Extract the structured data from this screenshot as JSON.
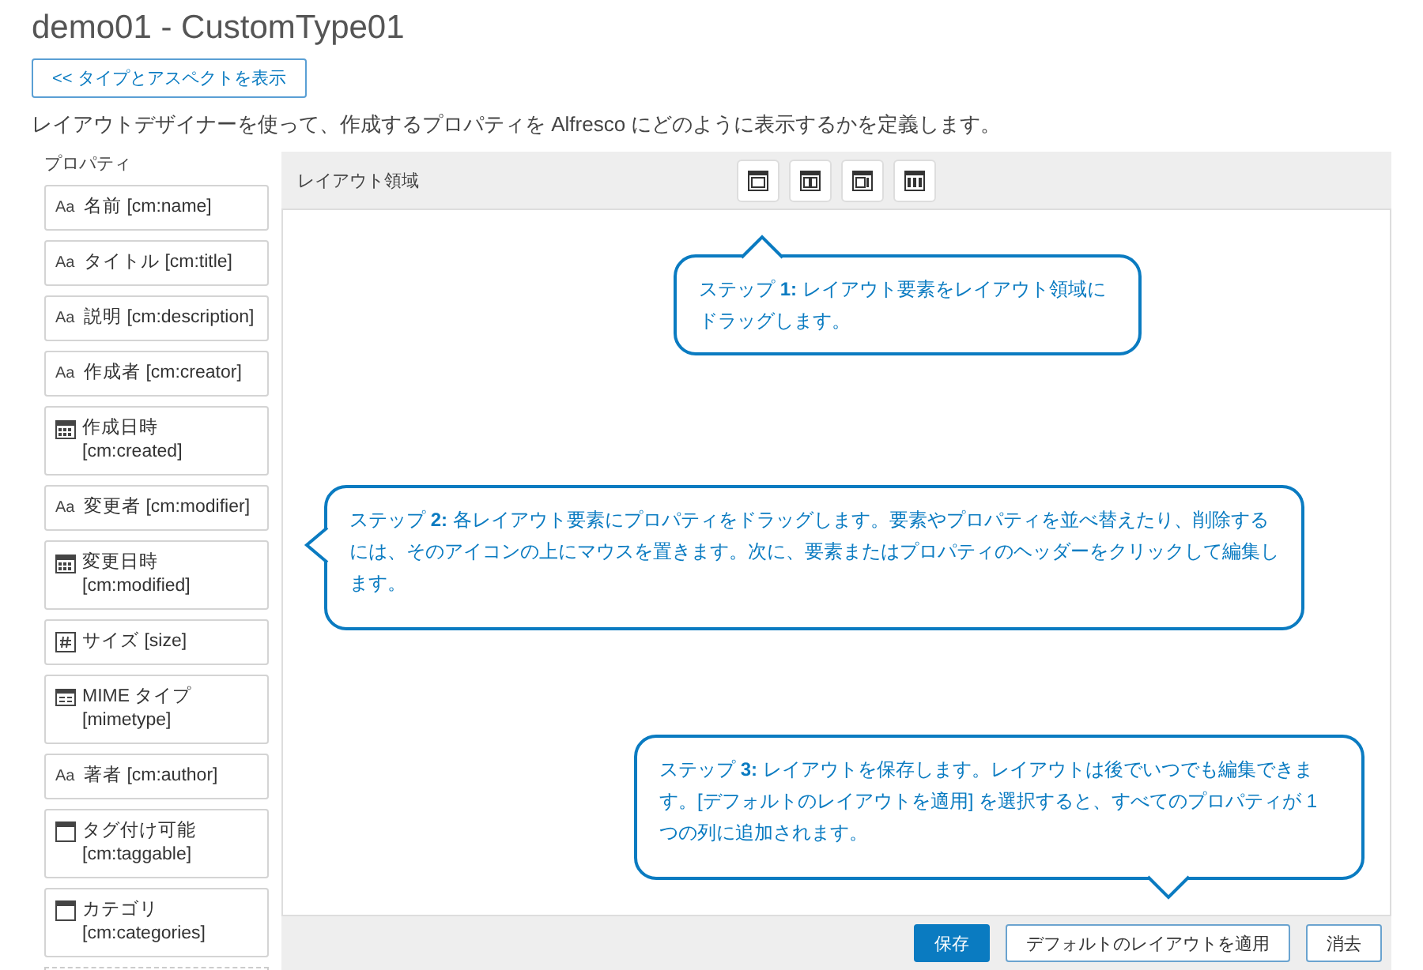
{
  "page": {
    "title": "demo01 - CustomType01",
    "back_button": "<< タイプとアスペクトを表示",
    "description": "レイアウトデザイナーを使って、作成するプロパティを Alfresco にどのように表示するかを定義します。"
  },
  "properties": {
    "heading": "プロパティ",
    "items": [
      {
        "kind": "text",
        "icon": "Aa",
        "label": "名前 [cm:name]"
      },
      {
        "kind": "text",
        "icon": "Aa",
        "label": "タイトル [cm:title]"
      },
      {
        "kind": "text",
        "icon": "Aa",
        "label": "説明 [cm:description]"
      },
      {
        "kind": "text",
        "icon": "Aa",
        "label": "作成者 [cm:creator]"
      },
      {
        "kind": "date",
        "label": "作成日時 [cm:created]"
      },
      {
        "kind": "text",
        "icon": "Aa",
        "label": "変更者 [cm:modifier]"
      },
      {
        "kind": "date",
        "label": "変更日時 [cm:modified]"
      },
      {
        "kind": "number",
        "label": "サイズ [size]"
      },
      {
        "kind": "mime",
        "label": "MIME タイプ [mimetype]"
      },
      {
        "kind": "text",
        "icon": "Aa",
        "label": "著者 [cm:author]"
      },
      {
        "kind": "boolean",
        "label": "タグ付け可能 [cm:taggable]"
      },
      {
        "kind": "boolean",
        "label": "カテゴリ [cm:categories]"
      }
    ]
  },
  "layout": {
    "heading": "レイアウト領域",
    "tools": [
      {
        "kind": "one-column"
      },
      {
        "kind": "two-columns"
      },
      {
        "kind": "sidebar"
      },
      {
        "kind": "three-columns"
      }
    ],
    "callouts": [
      {
        "kind": "top",
        "text": "ステップ **1:** レイアウト要素をレイアウト領域にドラッグします。"
      },
      {
        "kind": "left",
        "text": "ステップ **2:** 各レイアウト要素にプロパティをドラッグします。要素やプロパティを並べ替えたり、削除するには、そのアイコンの上にマウスを置きます。次に、要素またはプロパティのヘッダーをクリックして編集します。"
      },
      {
        "kind": "bottom",
        "text": "ステップ **3:** レイアウトを保存します。レイアウトは後でいつでも編集できます。[デフォルトのレイアウトを適用] を選択すると、すべてのプロパティが 1 つの列に追加されます。"
      }
    ]
  },
  "footer": {
    "buttons": [
      {
        "kind": "primary",
        "label": "保存"
      },
      {
        "kind": "secondary",
        "label": "デフォルトのレイアウトを適用"
      },
      {
        "kind": "secondary",
        "label": "消去"
      }
    ]
  }
}
